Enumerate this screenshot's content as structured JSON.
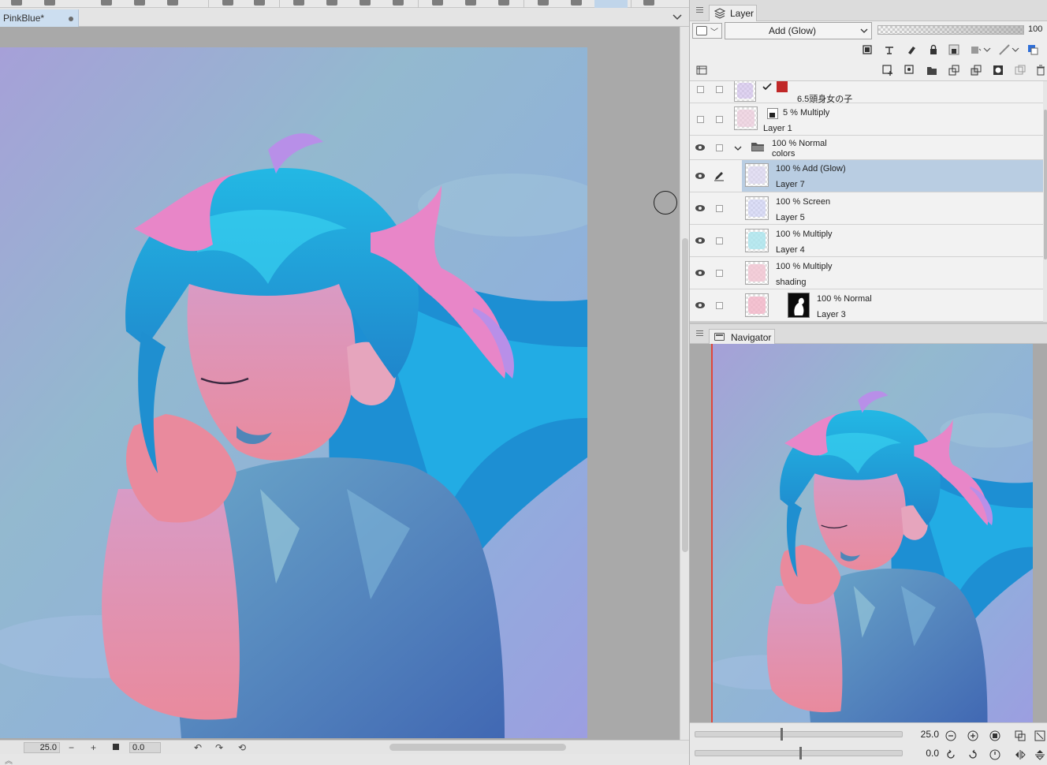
{
  "document": {
    "tab_title": "PinkBlue*"
  },
  "canvas_status": {
    "zoom": "25.0",
    "rotation": "0.0",
    "zoom_out": "−",
    "zoom_in": "+"
  },
  "layer_panel": {
    "tab_label": "Layer",
    "blend_mode": "Add (Glow)",
    "opacity": "100",
    "opacity_fraction": 1.0,
    "layers": [
      {
        "mode": "",
        "name": "6.5頭身女の子",
        "visible": false,
        "tint": "#c9b6e8"
      },
      {
        "mode": "5 % Multiply",
        "name": "Layer 1",
        "visible": false,
        "tint": "#e9c7d8"
      },
      {
        "mode": "100 % Normal",
        "name": "colors",
        "visible": true,
        "folder": true
      },
      {
        "mode": "100 % Add (Glow)",
        "name": "Layer 7",
        "visible": true,
        "selected": true,
        "tint": "#d7d2ee"
      },
      {
        "mode": "100 % Screen",
        "name": "Layer 5",
        "visible": true,
        "tint": "#c4c8f2"
      },
      {
        "mode": "100 % Multiply",
        "name": "Layer 4",
        "visible": true,
        "tint": "#a7e4ec"
      },
      {
        "mode": "100 % Multiply",
        "name": "shading",
        "visible": true,
        "tint": "#f0c2cf"
      },
      {
        "mode": "100 % Normal",
        "name": "Layer 3",
        "visible": true,
        "tint": "#f1b3c5",
        "mask": true
      }
    ]
  },
  "navigator": {
    "tab_label": "Navigator",
    "zoom": "25.0",
    "rotation": "0.0"
  },
  "colors": {
    "selection": "#b9cde2",
    "hair": "#1f9fd6",
    "ribbon": "#e886c8",
    "skin": "#e98a9d",
    "shirt": "#4f86b8",
    "background": "#8fb3d6"
  }
}
